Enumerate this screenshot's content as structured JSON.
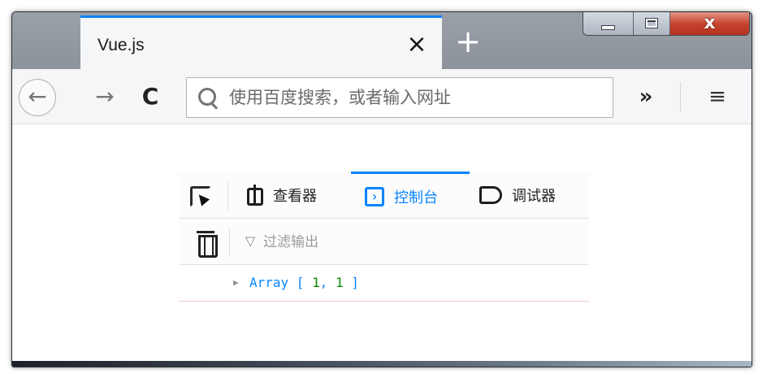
{
  "browser": {
    "tab": {
      "title": "Vue.js",
      "close_glyph": "×"
    },
    "new_tab_glyph": "+",
    "window_controls": {
      "close_glyph": "x"
    },
    "nav": {
      "back_glyph": "←",
      "forward_glyph": "→",
      "reload_glyph": "C",
      "overflow_glyph": "»",
      "menu_glyph": "≡"
    },
    "urlbar": {
      "value": "",
      "placeholder": "使用百度搜索，或者输入网址"
    },
    "accent_color": "#0a84ff"
  },
  "devtools": {
    "tabs": [
      {
        "label": "查看器",
        "icon": "inspector-icon",
        "active": false
      },
      {
        "label": "控制台",
        "icon": "console-icon",
        "active": true
      },
      {
        "label": "调试器",
        "icon": "debugger-icon",
        "active": false
      }
    ],
    "filter": {
      "value": "",
      "placeholder": "过滤输出",
      "icon_glyph": "▽"
    },
    "console": {
      "entries": [
        {
          "twisty": "▶",
          "prefix": "Array [ ",
          "items": [
            "1",
            "1"
          ],
          "separator": ", ",
          "suffix": " ]"
        }
      ],
      "colors": {
        "object": "#0a84ff",
        "number": "#058b00"
      }
    }
  }
}
